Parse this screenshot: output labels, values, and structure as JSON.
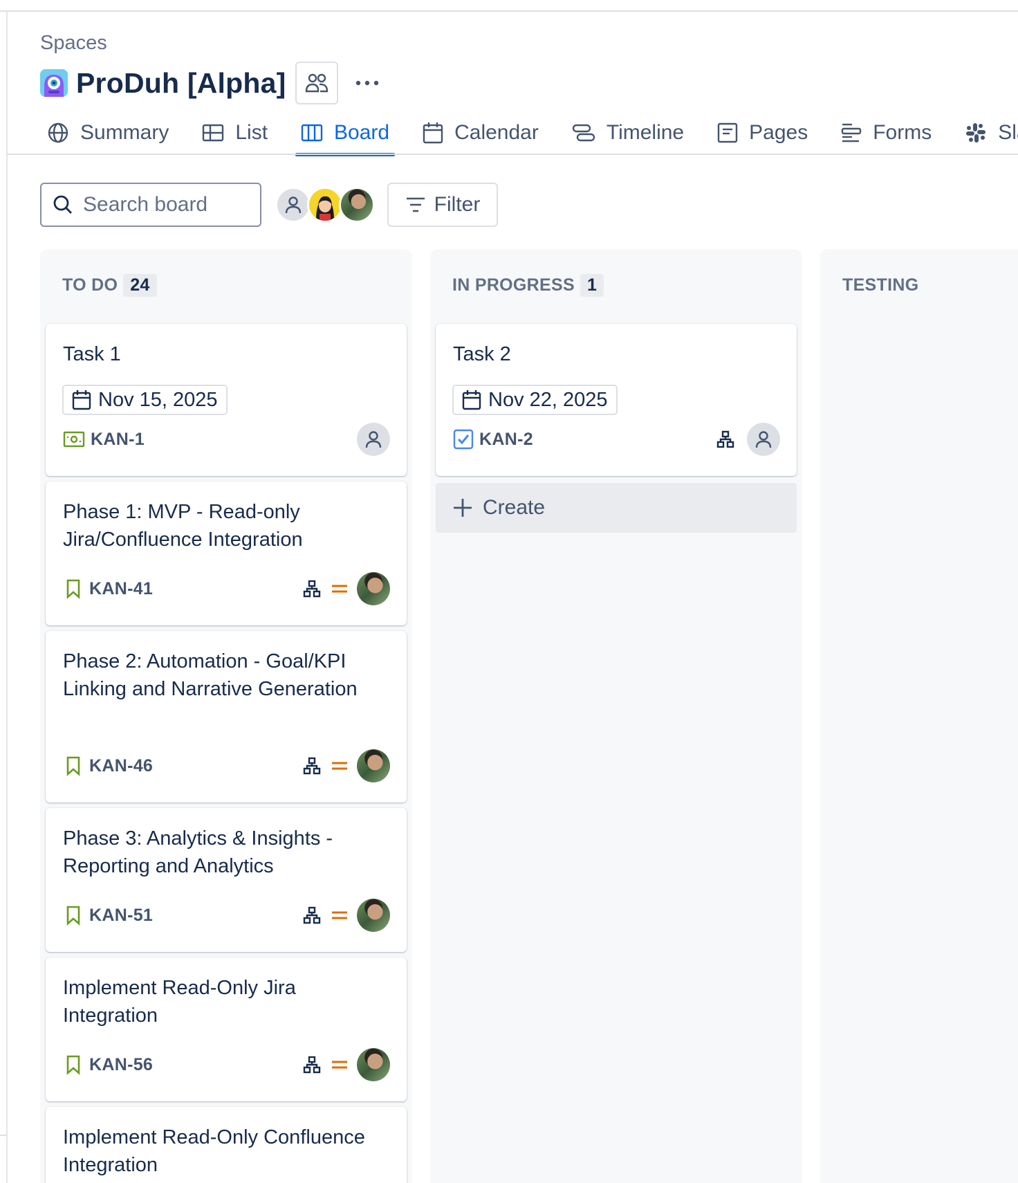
{
  "breadcrumb": "Spaces",
  "project": {
    "title": "ProDuh [Alpha]"
  },
  "tabs": [
    {
      "label": "Summary",
      "icon": "globe-icon"
    },
    {
      "label": "List",
      "icon": "list-icon"
    },
    {
      "label": "Board",
      "icon": "board-icon",
      "active": true
    },
    {
      "label": "Calendar",
      "icon": "calendar-icon"
    },
    {
      "label": "Timeline",
      "icon": "timeline-icon"
    },
    {
      "label": "Pages",
      "icon": "pages-icon"
    },
    {
      "label": "Forms",
      "icon": "forms-icon"
    },
    {
      "label": "Sla",
      "icon": "slack-icon"
    }
  ],
  "toolbar": {
    "search_placeholder": "Search board",
    "filter_label": "Filter"
  },
  "columns": [
    {
      "name": "TO DO",
      "count": "24",
      "cards": [
        {
          "title": "Task 1",
          "date": "Nov 15, 2025",
          "key": "KAN-1",
          "type": "subtask-icon",
          "assignee": "unassigned"
        },
        {
          "title": "Phase 1: MVP - Read-only Jira/Confluence Integration",
          "key": "KAN-41",
          "type": "story-icon",
          "priority": "medium",
          "assignee": "photo"
        },
        {
          "title": "Phase 2: Automation - Goal/KPI Linking and Narrative Generation",
          "key": "KAN-46",
          "type": "story-icon",
          "priority": "medium",
          "assignee": "photo"
        },
        {
          "title": "Phase 3: Analytics & Insights - Reporting and Analytics",
          "key": "KAN-51",
          "type": "story-icon",
          "priority": "medium",
          "assignee": "photo"
        },
        {
          "title": "Implement Read-Only Jira Integration",
          "key": "KAN-56",
          "type": "story-icon",
          "priority": "medium",
          "assignee": "photo"
        },
        {
          "title": "Implement Read-Only Confluence Integration",
          "key": "",
          "type": "story-icon"
        }
      ]
    },
    {
      "name": "IN PROGRESS",
      "count": "1",
      "cards": [
        {
          "title": "Task 2",
          "date": "Nov 22, 2025",
          "key": "KAN-2",
          "type": "task-icon",
          "assignee": "unassigned"
        }
      ],
      "create_label": "Create"
    },
    {
      "name": "TESTING",
      "count": "",
      "cards": []
    }
  ],
  "colors": {
    "accent": "#0c66e4",
    "story": "#6a9a23",
    "task": "#4688ec",
    "priority_medium": "#e06c00",
    "text": "#172b4d",
    "subtle_text": "#626f86"
  }
}
